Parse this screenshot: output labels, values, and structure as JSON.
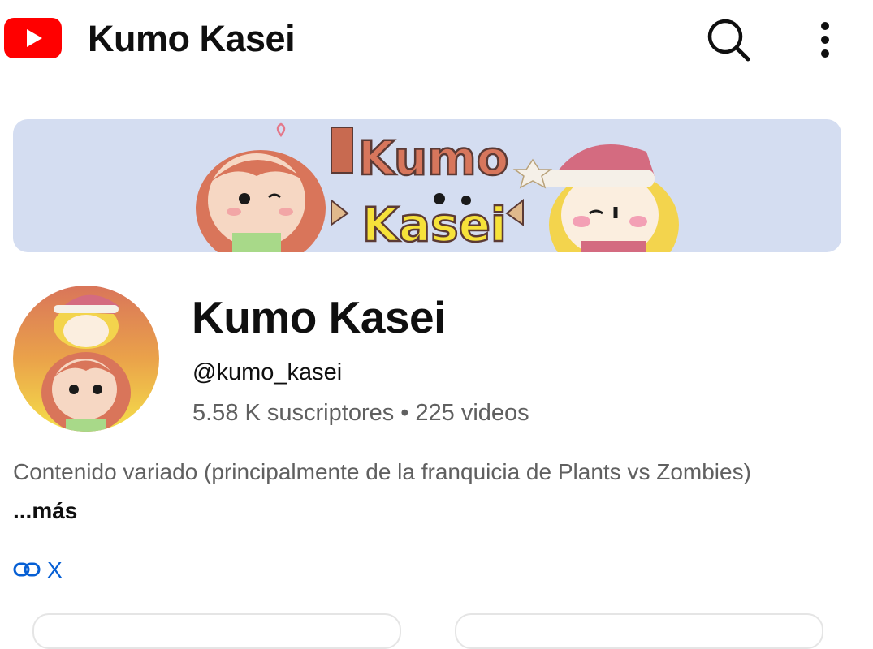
{
  "header": {
    "app_icon": "youtube-logo-icon",
    "title": "Kumo Kasei",
    "search_icon": "search-icon",
    "more_icon": "more-vert-icon"
  },
  "banner": {
    "art_text_line1": "Kumo",
    "art_text_line2": "Kasei",
    "background_color": "#d4ddf1"
  },
  "channel": {
    "name": "Kumo Kasei",
    "handle": "@kumo_kasei",
    "subscribers": "5.58 K suscriptores",
    "separator": "•",
    "videos": "225 videos"
  },
  "about": {
    "description": "Contenido variado (principalmente de la franquicia de Plants vs Zombies)",
    "more_label": "...más"
  },
  "links": {
    "icon": "link-icon",
    "label": "X"
  },
  "colors": {
    "brand_red": "#ff0000",
    "link_blue": "#065fd4",
    "secondary_text": "#606060"
  }
}
